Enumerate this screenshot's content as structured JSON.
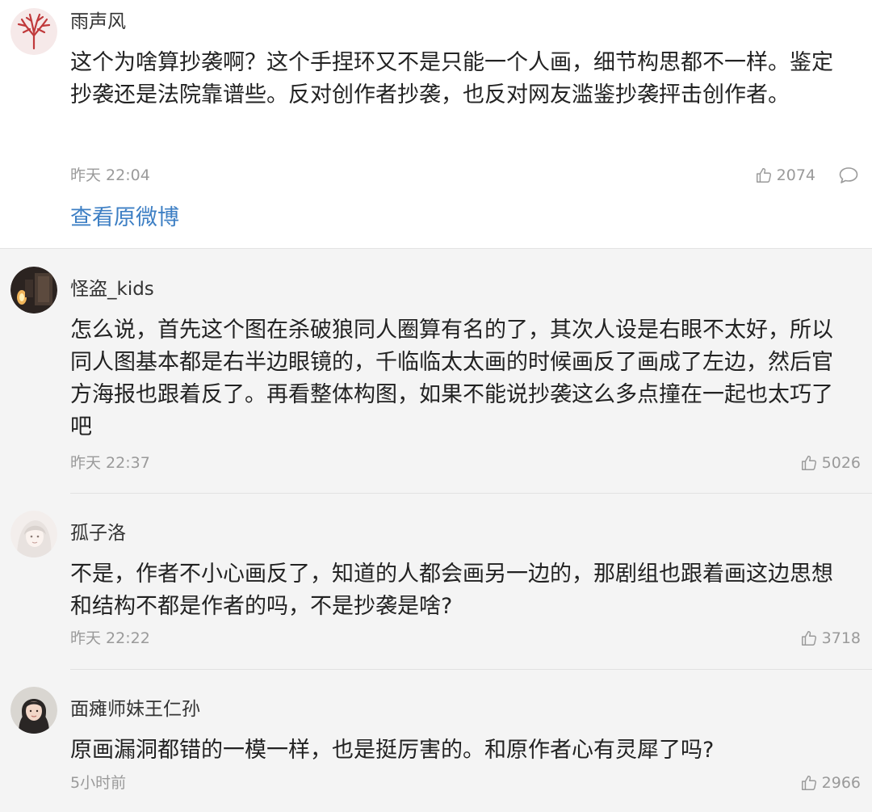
{
  "comments": [
    {
      "user": "雨声风",
      "text": "这个为啥算抄袭啊？这个手捏环又不是只能一个人画，细节构思都不一样。鉴定抄袭还是法院靠谱些。反对创作者抄袭，也反对网友滥鉴抄袭抨击创作者。",
      "time": "昨天 22:04",
      "likes": "2074",
      "link": "查看原微博"
    },
    {
      "user": "怪盗_kids",
      "text": "怎么说，首先这个图在杀破狼同人圈算有名的了，其次人设是右眼不太好，所以同人图基本都是右半边眼镜的，千临临太太画的时候画反了画成了左边，然后官方海报也跟着反了。再看整体构图，如果不能说抄袭这么多点撞在一起也太巧了吧",
      "time": "昨天 22:37",
      "likes": "5026"
    },
    {
      "user": "孤子洛",
      "text": "不是，作者不小心画反了，知道的人都会画另一边的，那剧组也跟着画这边思想和结构不都是作者的吗，不是抄袭是啥?",
      "time": "昨天 22:22",
      "likes": "3718"
    },
    {
      "user": "面瘫师妹王仁孙",
      "text": "原画漏洞都错的一模一样，也是挺厉害的。和原作者心有灵犀了吗?",
      "time": "5小时前",
      "likes": "2966"
    }
  ],
  "colors": {
    "link": "#3d7fc4",
    "meta": "#9a9a9a",
    "reply_bg": "#f4f4f4",
    "top_bg": "#ffffff"
  },
  "icons": {
    "like": "thumbs-up-icon",
    "comment": "comment-bubble-icon"
  }
}
